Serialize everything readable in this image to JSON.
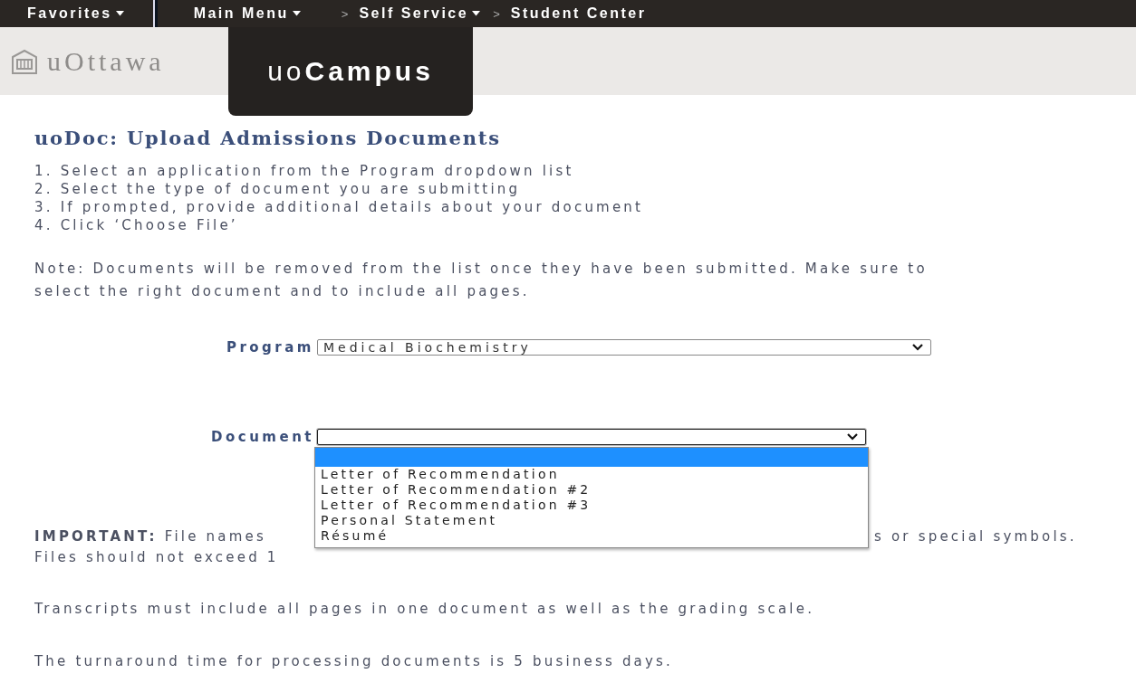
{
  "nav": {
    "items": [
      {
        "kind": "menu",
        "label": "Favorites"
      },
      {
        "kind": "divider"
      },
      {
        "kind": "menu",
        "label": "Main Menu"
      },
      {
        "kind": "separator",
        "label": ">"
      },
      {
        "kind": "menu",
        "label": "Self Service"
      },
      {
        "kind": "separator",
        "label": ">"
      },
      {
        "kind": "link",
        "label": "Student Center"
      }
    ]
  },
  "header": {
    "logo_text": "uOttawa",
    "tab": "uo**Campus**"
  },
  "title": "uoDoc: Upload Admissions Documents",
  "steps": [
    "1. Select an application from the Program dropdown list",
    "2. Select the type of document you are submitting",
    "3. If prompted, provide additional details about your document",
    "4. Click ‘Choose File’"
  ],
  "note": "Note: Documents will be removed from the list once they have been submitted. Make sure to select the right document and to include all pages.",
  "form": {
    "program": {
      "label": "Program",
      "value": "Medical Biochemistry"
    },
    "document": {
      "label": "Document",
      "expanded": true,
      "options": [
        {
          "selected": true
        },
        {
          "label": "Letter of Recommendation",
          "selected": false
        },
        {
          "label": "Letter of Recommendation #2",
          "selected": false
        },
        {
          "label": "Letter of Recommendation #3",
          "selected": false
        },
        {
          "label": "Personal Statement",
          "selected": false
        },
        {
          "label": "Résumé",
          "selected": false
        }
      ]
    }
  },
  "important": {
    "line_1_start": "**IMPORTANT:** File names",
    "line_1_end": "s or special symbols.",
    "line_2_start": "Files should not exceed 1"
  },
  "paragraphs": [
    "Transcripts must include all pages in one document as well as the grading scale.",
    "The turnaround time for processing documents is 5 business days."
  ]
}
